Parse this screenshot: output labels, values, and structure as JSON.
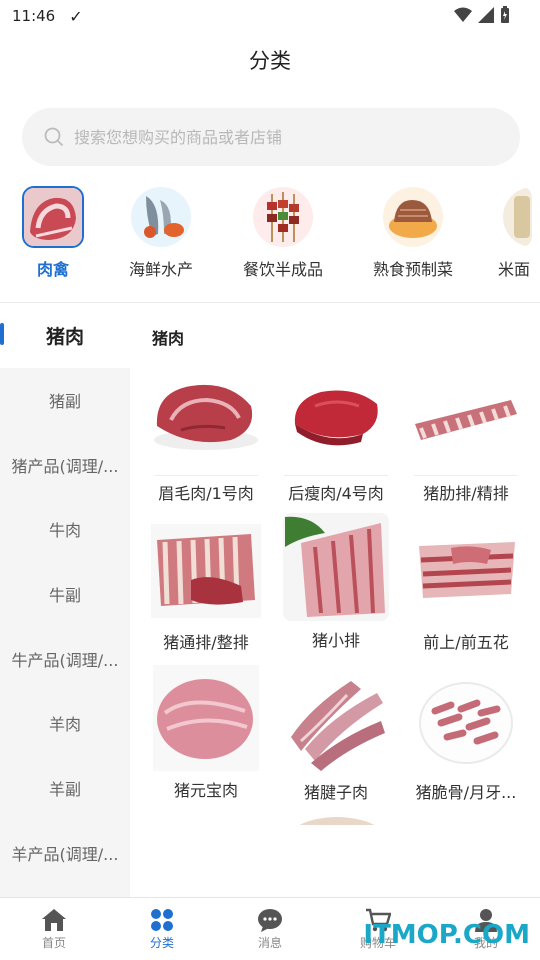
{
  "status": {
    "time": "11:46"
  },
  "header": {
    "title": "分类"
  },
  "search": {
    "placeholder": "搜索您想购买的商品或者店铺"
  },
  "top_categories": [
    {
      "label": "肉禽",
      "icon": "meat-icon",
      "active": true
    },
    {
      "label": "海鲜水产",
      "icon": "seafood-icon",
      "active": false
    },
    {
      "label": "餐饮半成品",
      "icon": "skewer-icon",
      "active": false
    },
    {
      "label": "熟食预制菜",
      "icon": "deli-icon",
      "active": false
    },
    {
      "label": "米面",
      "icon": "rice-icon",
      "active": false
    }
  ],
  "sidebar": {
    "items": [
      {
        "label": "猪肉",
        "active": true
      },
      {
        "label": "猪副"
      },
      {
        "label": "猪产品(调理/..."
      },
      {
        "label": "牛肉"
      },
      {
        "label": "牛副"
      },
      {
        "label": "牛产品(调理/..."
      },
      {
        "label": "羊肉"
      },
      {
        "label": "羊副"
      },
      {
        "label": "羊产品(调理/..."
      }
    ]
  },
  "panel": {
    "title": "猪肉",
    "products": [
      {
        "name": "眉毛肉/1号肉",
        "icon": "pork-shoulder-image"
      },
      {
        "name": "后瘦肉/4号肉",
        "icon": "lean-pork-image"
      },
      {
        "name": "猪肋排/精排",
        "icon": "pork-ribs-image"
      },
      {
        "name": "猪通排/整排",
        "icon": "whole-ribs-image"
      },
      {
        "name": "猪小排",
        "icon": "small-ribs-image"
      },
      {
        "name": "前上/前五花",
        "icon": "pork-belly-image"
      },
      {
        "name": "猪元宝肉",
        "icon": "pork-round-image"
      },
      {
        "name": "猪腱子肉",
        "icon": "pork-shank-image"
      },
      {
        "name": "猪脆骨/月牙...",
        "icon": "cartilage-image"
      }
    ]
  },
  "bottom_nav": [
    {
      "label": "首页",
      "icon": "home-icon",
      "active": false
    },
    {
      "label": "分类",
      "icon": "category-icon",
      "active": true
    },
    {
      "label": "消息",
      "icon": "message-icon",
      "active": false
    },
    {
      "label": "购物车",
      "icon": "cart-icon",
      "active": false
    },
    {
      "label": "我的",
      "icon": "profile-icon",
      "active": false
    }
  ],
  "watermark": "ITMOP.COM",
  "colors": {
    "accent": "#1f6fd1",
    "sidebar_bg": "#f5f5f5",
    "meat": "#c8484e"
  }
}
